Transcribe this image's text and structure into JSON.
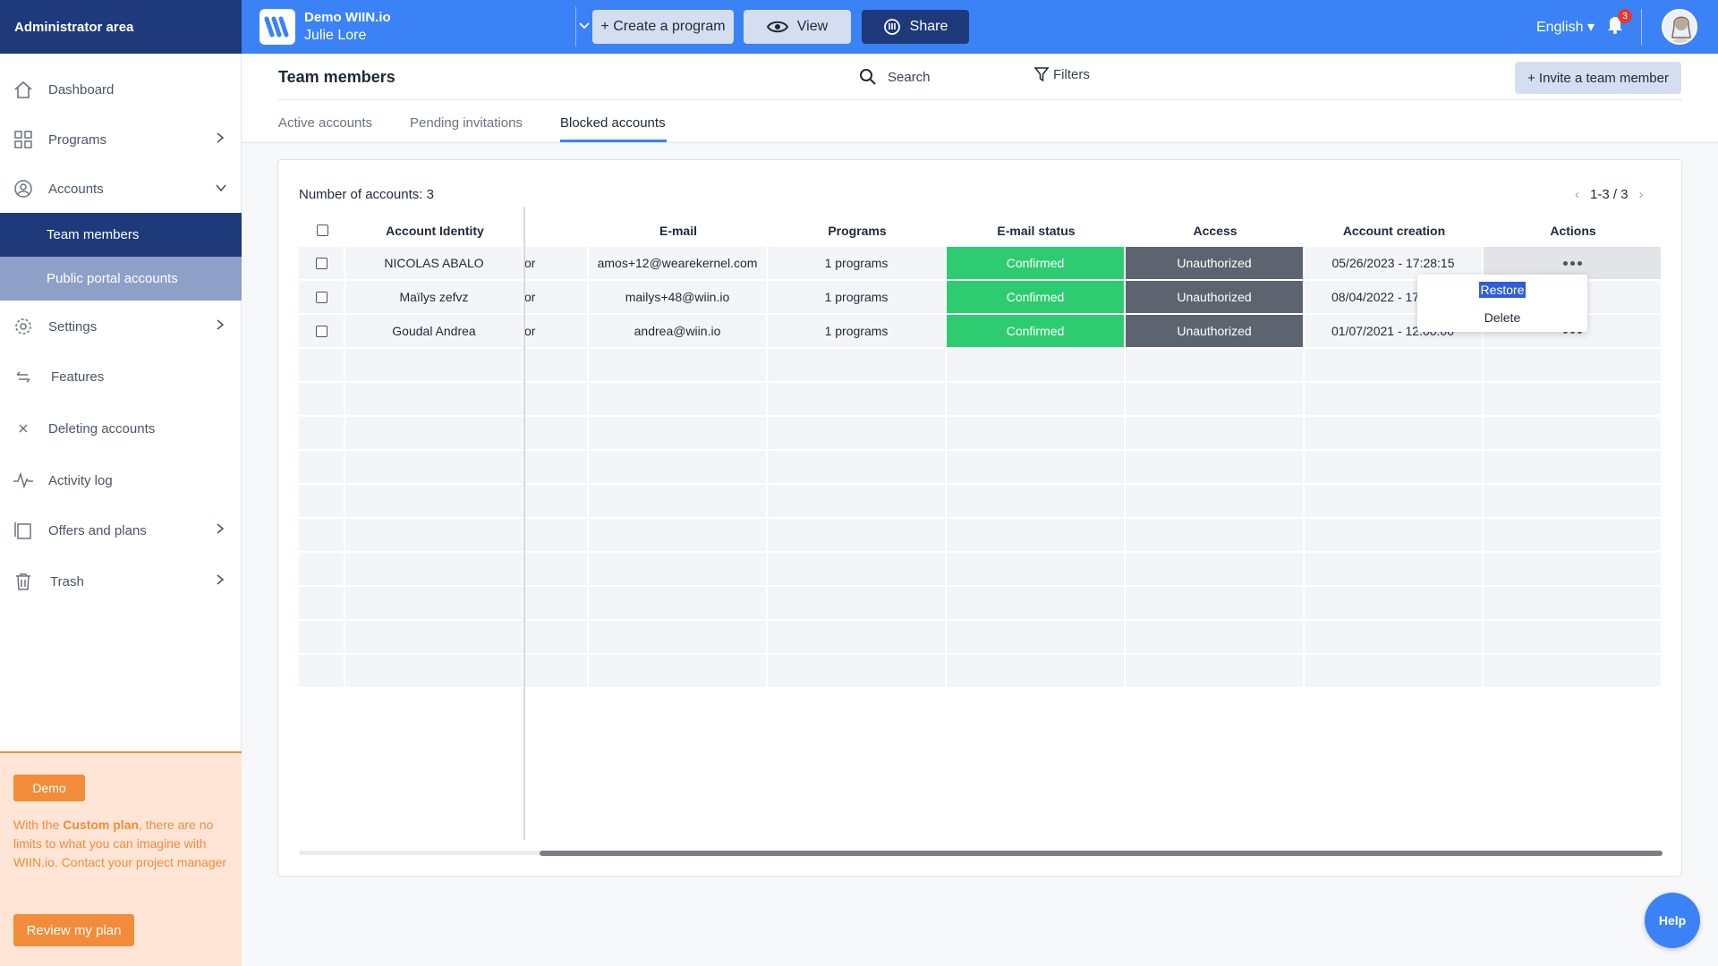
{
  "topbar": {
    "admin_label": "Administrator area",
    "brand_name": "Demo WIIN.io",
    "brand_user": "Julie Lore",
    "create_label": "+ Create a program",
    "view_label": "View",
    "share_label": "Share",
    "language": "English",
    "notif_count": "3",
    "accent": "#3b82f6",
    "dark": "#1e3a7a"
  },
  "sidebar": {
    "items": [
      {
        "label": "Dashboard",
        "icon": "home-icon"
      },
      {
        "label": "Programs",
        "icon": "grid-icon"
      },
      {
        "label": "Accounts",
        "icon": "user-circle-icon"
      },
      {
        "label": "Team members"
      },
      {
        "label": "Public portal accounts"
      },
      {
        "label": "Settings",
        "icon": "gear-icon"
      },
      {
        "label": "Features",
        "icon": "arrows-icon"
      },
      {
        "label": "Deleting accounts",
        "icon": "close-icon"
      },
      {
        "label": "Activity log",
        "icon": "pulse-icon"
      },
      {
        "label": "Offers and plans",
        "icon": "pages-icon"
      },
      {
        "label": "Trash",
        "icon": "trash-icon"
      }
    ],
    "promo": {
      "tag": "Demo",
      "text_before": "With the ",
      "text_bold": "Custom plan",
      "text_after": ", there are no limits to what you can imagine with WIIN.io. Contact your project manager",
      "button": "Review my plan"
    }
  },
  "header": {
    "title": "Team members",
    "search": "Search",
    "filters": "Filters",
    "invite": "+ Invite a team member",
    "tabs": [
      "Active accounts",
      "Pending invitations",
      "Blocked accounts"
    ],
    "active_tab": "Blocked accounts"
  },
  "card": {
    "count": "Number of accounts: 3",
    "pager": "1-3 / 3"
  },
  "table": {
    "columns": [
      "Account Identity",
      "E-mail",
      "Programs",
      "E-mail status",
      "Access",
      "Account creation",
      "Actions"
    ],
    "rows": [
      {
        "identity": "NICOLAS ABALO",
        "hidden": "or",
        "email": "amos+12@wearekernel.com",
        "programs": "1 programs",
        "status": "Confirmed",
        "access": "Unauthorized",
        "created": "05/26/2023 - 17:28:15"
      },
      {
        "identity": "Maïlys zefvz",
        "hidden": "or",
        "email": "mailys+48@wiin.io",
        "programs": "1 programs",
        "status": "Confirmed",
        "access": "Unauthorized",
        "created": "08/04/2022 - 17:"
      },
      {
        "identity": "Goudal Andrea",
        "hidden": "or",
        "email": "andrea@wiin.io",
        "programs": "1 programs",
        "status": "Confirmed",
        "access": "Unauthorized",
        "created": "01/07/2021 - 12:00:00"
      }
    ],
    "status_color": "#2ecc71",
    "access_color": "#5d6470"
  },
  "menu": {
    "restore": "Restore",
    "delete": "Delete"
  },
  "help": "Help"
}
